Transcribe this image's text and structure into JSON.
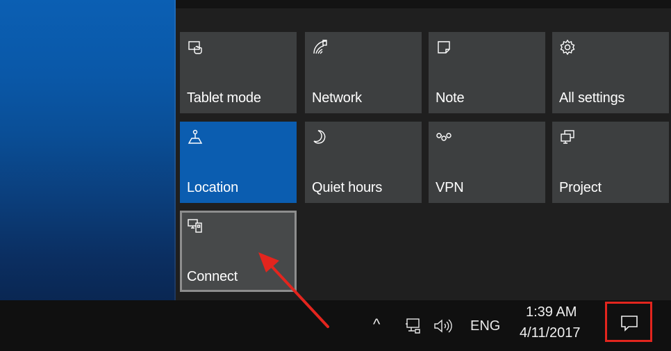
{
  "quick_actions": [
    {
      "label": "Tablet mode",
      "icon": "tablet-mode-icon",
      "state": "off"
    },
    {
      "label": "Network",
      "icon": "network-icon",
      "state": "off"
    },
    {
      "label": "Note",
      "icon": "note-icon",
      "state": "off"
    },
    {
      "label": "All settings",
      "icon": "gear-icon",
      "state": "off"
    },
    {
      "label": "Location",
      "icon": "location-icon",
      "state": "on"
    },
    {
      "label": "Quiet hours",
      "icon": "moon-icon",
      "state": "off"
    },
    {
      "label": "VPN",
      "icon": "vpn-icon",
      "state": "off"
    },
    {
      "label": "Project",
      "icon": "project-icon",
      "state": "off"
    },
    {
      "label": "Connect",
      "icon": "connect-icon",
      "state": "highlighted"
    }
  ],
  "taskbar": {
    "show_hidden_icons": "^",
    "language": "ENG",
    "time": "1:39 AM",
    "date": "4/11/2017"
  },
  "colors": {
    "active_tile": "#0b5db0",
    "tile": "#3d3f40",
    "annotation_red": "#e3251e"
  }
}
